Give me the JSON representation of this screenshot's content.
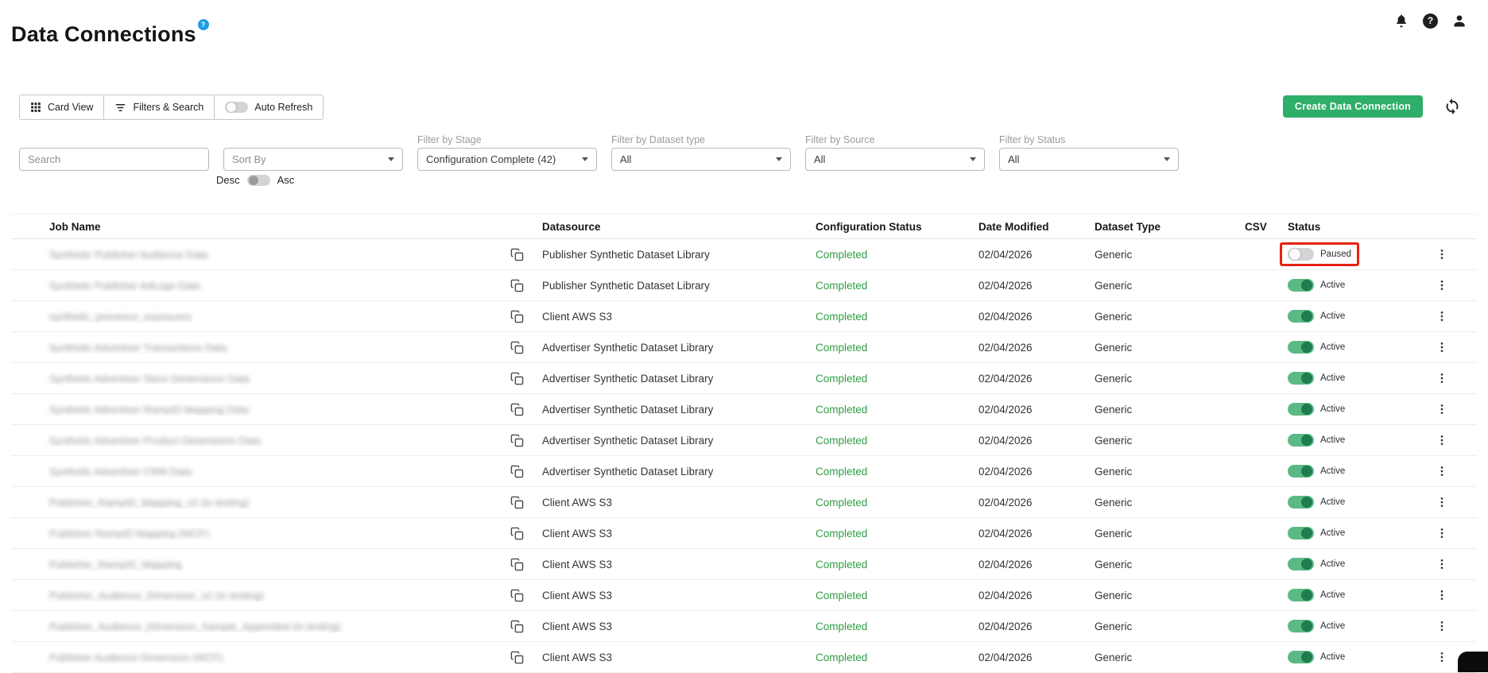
{
  "page": {
    "title": "Data Connections",
    "title_badge": "?"
  },
  "colors": {
    "primary_green": "#2eae68",
    "completed_green": "#2f9e44",
    "toggle_active_track": "#5cb985",
    "toggle_active_knob": "#1e7d4f",
    "toggle_off_track": "#d4d4d4",
    "highlight_red": "#e8220f",
    "badge_blue": "#1e9de3"
  },
  "icons": {
    "help_glyph": "?",
    "names": [
      "notifications-icon",
      "help-icon",
      "account-icon",
      "card-view-icon",
      "filter-icon",
      "refresh-icon",
      "copy-icon",
      "kebab-menu-icon",
      "caret-down-icon"
    ]
  },
  "toolbar": {
    "card_view_label": "Card View",
    "filters_label": "Filters & Search",
    "auto_refresh_label": "Auto Refresh",
    "create_button_label": "Create Data Connection"
  },
  "filters": {
    "search": {
      "placeholder": "Search"
    },
    "sort_by": {
      "placeholder": "Sort By"
    },
    "order": {
      "desc": "Desc",
      "asc": "Asc"
    },
    "stage": {
      "label": "Filter by Stage",
      "value": "Configuration Complete (42)"
    },
    "dataset_type": {
      "label": "Filter by Dataset type",
      "value": "All"
    },
    "source": {
      "label": "Filter by Source",
      "value": "All"
    },
    "status": {
      "label": "Filter by Status",
      "value": "All"
    }
  },
  "table": {
    "columns": [
      "Job Name",
      "Datasource",
      "Configuration Status",
      "Date Modified",
      "Dataset Type",
      "CSV",
      "Status"
    ],
    "rows": [
      {
        "job_name": "Synthetic Publisher Audience Data",
        "datasource": "Publisher Synthetic Dataset Library",
        "config_status": "Completed",
        "date_modified": "02/04/2026",
        "dataset_type": "Generic",
        "csv": "",
        "status": "Paused",
        "status_active": false,
        "highlighted": true
      },
      {
        "job_name": "Synthetic Publisher AdLogs Data",
        "datasource": "Publisher Synthetic Dataset Library",
        "config_status": "Completed",
        "date_modified": "02/04/2026",
        "dataset_type": "Generic",
        "csv": "",
        "status": "Active",
        "status_active": true,
        "highlighted": false
      },
      {
        "job_name": "synthetic_presence_exposures",
        "datasource": "Client AWS S3",
        "config_status": "Completed",
        "date_modified": "02/04/2026",
        "dataset_type": "Generic",
        "csv": "",
        "status": "Active",
        "status_active": true,
        "highlighted": false
      },
      {
        "job_name": "Synthetic Advertiser Transactions Data",
        "datasource": "Advertiser Synthetic Dataset Library",
        "config_status": "Completed",
        "date_modified": "02/04/2026",
        "dataset_type": "Generic",
        "csv": "",
        "status": "Active",
        "status_active": true,
        "highlighted": false
      },
      {
        "job_name": "Synthetic Advertiser Store Dimensions Data",
        "datasource": "Advertiser Synthetic Dataset Library",
        "config_status": "Completed",
        "date_modified": "02/04/2026",
        "dataset_type": "Generic",
        "csv": "",
        "status": "Active",
        "status_active": true,
        "highlighted": false
      },
      {
        "job_name": "Synthetic Advertiser RampID Mapping Data",
        "datasource": "Advertiser Synthetic Dataset Library",
        "config_status": "Completed",
        "date_modified": "02/04/2026",
        "dataset_type": "Generic",
        "csv": "",
        "status": "Active",
        "status_active": true,
        "highlighted": false
      },
      {
        "job_name": "Synthetic Advertiser Product Dimensions Data",
        "datasource": "Advertiser Synthetic Dataset Library",
        "config_status": "Completed",
        "date_modified": "02/04/2026",
        "dataset_type": "Generic",
        "csv": "",
        "status": "Active",
        "status_active": true,
        "highlighted": false
      },
      {
        "job_name": "Synthetic Advertiser CRM Data",
        "datasource": "Advertiser Synthetic Dataset Library",
        "config_status": "Completed",
        "date_modified": "02/04/2026",
        "dataset_type": "Generic",
        "csv": "",
        "status": "Active",
        "status_active": true,
        "highlighted": false
      },
      {
        "job_name": "Publisher_RampID_Mapping_v2 (in testing)",
        "datasource": "Client AWS S3",
        "config_status": "Completed",
        "date_modified": "02/04/2026",
        "dataset_type": "Generic",
        "csv": "",
        "status": "Active",
        "status_active": true,
        "highlighted": false
      },
      {
        "job_name": "Publisher RampID Mapping (WCF)",
        "datasource": "Client AWS S3",
        "config_status": "Completed",
        "date_modified": "02/04/2026",
        "dataset_type": "Generic",
        "csv": "",
        "status": "Active",
        "status_active": true,
        "highlighted": false
      },
      {
        "job_name": "Publisher_RampID_Mapping",
        "datasource": "Client AWS S3",
        "config_status": "Completed",
        "date_modified": "02/04/2026",
        "dataset_type": "Generic",
        "csv": "",
        "status": "Active",
        "status_active": true,
        "highlighted": false
      },
      {
        "job_name": "Publisher_Audience_Dimension_v2 (in testing)",
        "datasource": "Client AWS S3",
        "config_status": "Completed",
        "date_modified": "02/04/2026",
        "dataset_type": "Generic",
        "csv": "",
        "status": "Active",
        "status_active": true,
        "highlighted": false
      },
      {
        "job_name": "Publisher_Audience_Dimension_Sample_Appended (in testing)",
        "datasource": "Client AWS S3",
        "config_status": "Completed",
        "date_modified": "02/04/2026",
        "dataset_type": "Generic",
        "csv": "",
        "status": "Active",
        "status_active": true,
        "highlighted": false
      },
      {
        "job_name": "Publisher Audience Dimension (WCF)",
        "datasource": "Client AWS S3",
        "config_status": "Completed",
        "date_modified": "02/04/2026",
        "dataset_type": "Generic",
        "csv": "",
        "status": "Active",
        "status_active": true,
        "highlighted": false
      }
    ]
  }
}
